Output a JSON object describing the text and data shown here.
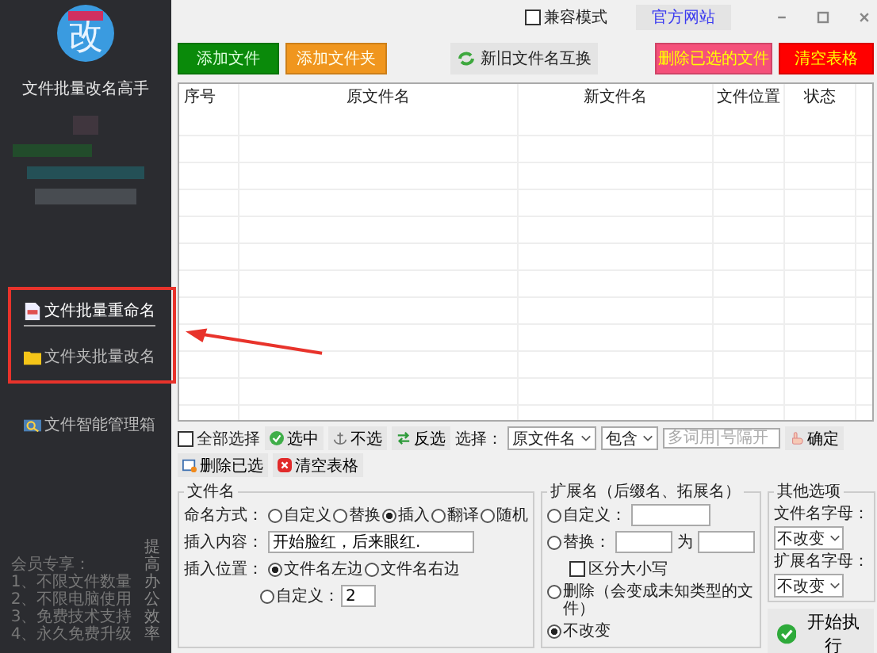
{
  "window": {
    "compat_mode": {
      "label": "兼容模式",
      "checked": false
    },
    "website_button": "官方网站"
  },
  "sidebar": {
    "logo_glyph": "改",
    "app_title": "文件批量改名高手",
    "nav": [
      {
        "label": "文件批量重命名",
        "kind": "document",
        "selected": true
      },
      {
        "label": "文件夹批量改名",
        "kind": "folder",
        "selected": false
      },
      {
        "label": "文件智能管理箱",
        "kind": "magnifier",
        "selected": false
      }
    ],
    "member_title": "会员专享：",
    "member_perks": [
      "1、不限文件数量",
      "2、不限电脑使用",
      "3、免费技术支持",
      "4、永久免费升级"
    ],
    "slogan": "提高办公效率"
  },
  "toolbar": [
    {
      "label": "添加文件",
      "kind": "filled",
      "color": "#0a8a0a"
    },
    {
      "label": "添加文件夹",
      "kind": "filled",
      "color": "#f0961e"
    },
    {
      "label": "新旧文件名互换",
      "kind": "swap"
    },
    {
      "label": "删除已选的文件",
      "kind": "filled",
      "color": "#f5507a"
    },
    {
      "label": "清空表格",
      "kind": "filled",
      "color": "#ff0000"
    }
  ],
  "table": {
    "columns": [
      "序号",
      "原文件名",
      "新文件名",
      "文件位置",
      "状态"
    ]
  },
  "selection_bar": {
    "select_all": {
      "label": "全部选择",
      "checked": false
    },
    "actions": [
      {
        "label": "选中",
        "kind": "check"
      },
      {
        "label": "不选",
        "kind": "anchor"
      },
      {
        "label": "反选",
        "kind": "swap"
      }
    ],
    "select_label": "选择：",
    "field_select": "原文件名",
    "match_select": "包含",
    "keyword": {
      "placeholder": "多词用|号隔开"
    },
    "tools": [
      {
        "label": "确定",
        "kind": "hand"
      },
      {
        "label": "删除已选",
        "kind": "window"
      },
      {
        "label": "清空表格",
        "kind": "clear"
      }
    ]
  },
  "filename_group": {
    "title": "文件名",
    "mode_label": "命名方式：",
    "modes": [
      {
        "label": "自定义",
        "selected": false
      },
      {
        "label": "替换",
        "selected": false
      },
      {
        "label": "插入",
        "selected": true
      },
      {
        "label": "翻译",
        "selected": false
      },
      {
        "label": "随机",
        "selected": false
      }
    ],
    "content_label": "插入内容：",
    "content_value": "开始脸红，后来眼红.",
    "position_label": "插入位置：",
    "positions": [
      {
        "label": "文件名左边",
        "selected": true
      },
      {
        "label": "文件名右边",
        "selected": false
      },
      {
        "label": "自定义：",
        "selected": false
      }
    ],
    "custom_position_value": "2"
  },
  "extension_group": {
    "title": "扩展名（后缀名、拓展名）",
    "custom": {
      "label": "自定义：",
      "selected": false
    },
    "replace": {
      "label": "替换：",
      "selected": false,
      "to_label": "为"
    },
    "case_sensitive": {
      "label": "区分大小写",
      "checked": false
    },
    "delete": {
      "label": "删除（会变成未知类型的文件）",
      "selected": false
    },
    "keep": {
      "label": "不改变",
      "selected": true
    }
  },
  "other_group": {
    "title": "其他选项",
    "rows": [
      {
        "label": "文件名字母：",
        "value": "不改变"
      },
      {
        "label": "扩展名字母：",
        "value": "不改变"
      }
    ]
  },
  "start_button": "开始执行"
}
